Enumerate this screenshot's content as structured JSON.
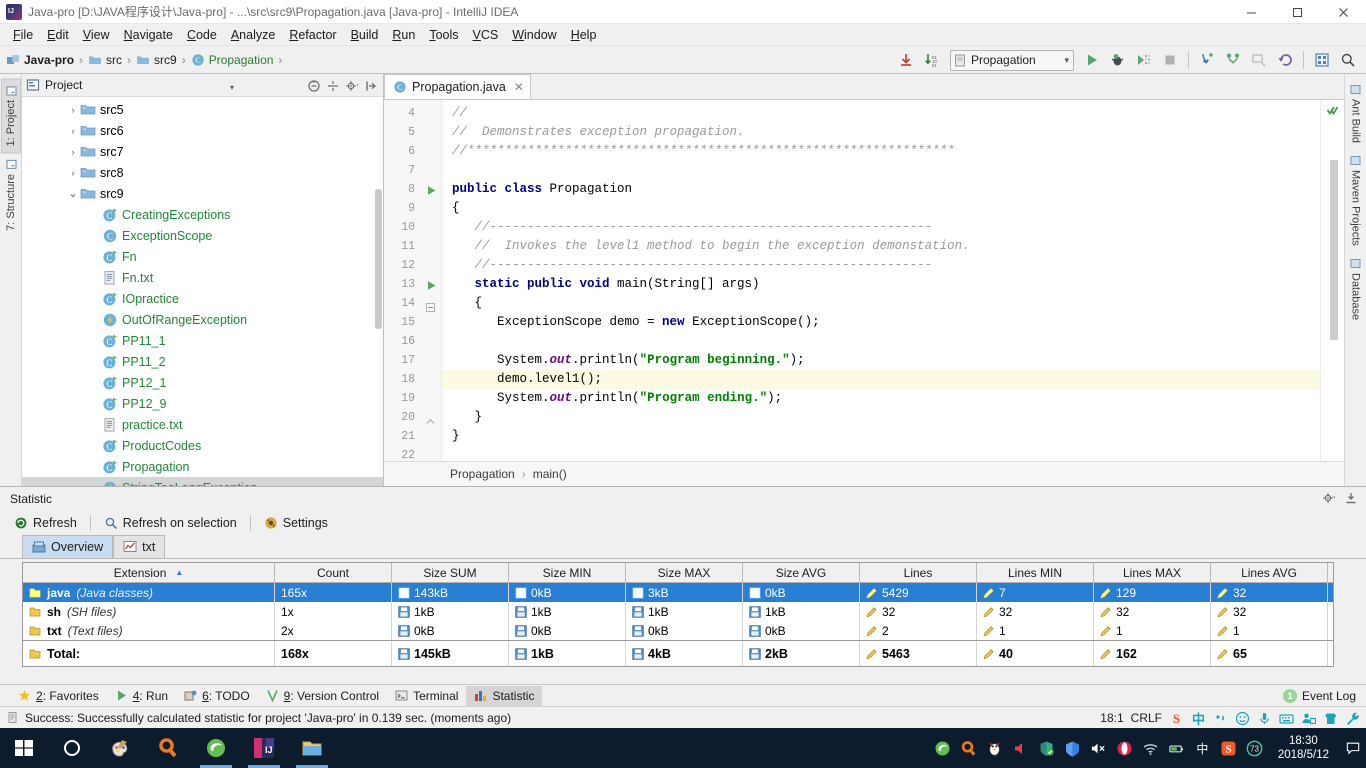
{
  "window": {
    "title": "Java-pro [D:\\JAVA程序设计\\Java-pro] - ...\\src\\src9\\Propagation.java [Java-pro] - IntelliJ IDEA",
    "app_icon": "intellij-idea-icon",
    "minimize": "–",
    "maximize": "❐",
    "close": "✕"
  },
  "menubar": {
    "items": [
      {
        "label": "File"
      },
      {
        "label": "Edit"
      },
      {
        "label": "View"
      },
      {
        "label": "Navigate"
      },
      {
        "label": "Code"
      },
      {
        "label": "Analyze"
      },
      {
        "label": "Refactor"
      },
      {
        "label": "Build"
      },
      {
        "label": "Run"
      },
      {
        "label": "Tools"
      },
      {
        "label": "VCS"
      },
      {
        "label": "Window"
      },
      {
        "label": "Help"
      }
    ]
  },
  "navbar": {
    "breadcrumb": [
      {
        "label": "Java-pro",
        "icon": "module-icon"
      },
      {
        "label": "src",
        "icon": "folder-icon"
      },
      {
        "label": "src9",
        "icon": "folder-icon"
      },
      {
        "label": "Propagation",
        "icon": "java-class-icon"
      }
    ],
    "separator": "›",
    "run_config": {
      "label": "Propagation",
      "caret": "▾",
      "icon": "run-config-icon"
    },
    "buttons": [
      {
        "name": "update-project-icon"
      },
      {
        "name": "compare-icon"
      },
      {
        "name": "run-icon"
      },
      {
        "name": "debug-icon"
      },
      {
        "name": "run-coverage-icon"
      },
      {
        "name": "stop-icon"
      },
      {
        "name": "vcs-update-icon"
      },
      {
        "name": "vcs-commit-icon"
      },
      {
        "name": "vcs-history-icon"
      },
      {
        "name": "vcs-rollback-icon"
      },
      {
        "name": "database-icon"
      },
      {
        "name": "search-everywhere-icon"
      }
    ]
  },
  "left_strip": {
    "tabs": [
      {
        "label": "1: Project",
        "active": true,
        "icon": "project-icon"
      },
      {
        "label": "7: Structure",
        "active": false,
        "icon": "structure-icon"
      }
    ]
  },
  "right_strip": {
    "tabs": [
      {
        "label": "Ant Build",
        "icon": "ant-icon"
      },
      {
        "label": "Maven Projects",
        "icon": "maven-icon"
      },
      {
        "label": "Database",
        "icon": "database-icon"
      }
    ]
  },
  "project_panel": {
    "title": "Project",
    "caret": "▾",
    "tools": [
      "collapse-all-icon",
      "expand-icon",
      "settings-gear-icon",
      "hide-icon"
    ],
    "tree": [
      {
        "label": "src5",
        "arrow": "›",
        "icon": "folder-icon",
        "indent": 0,
        "kind": "folder"
      },
      {
        "label": "src6",
        "arrow": "›",
        "icon": "folder-icon",
        "indent": 0,
        "kind": "folder"
      },
      {
        "label": "src7",
        "arrow": "›",
        "icon": "folder-icon",
        "indent": 0,
        "kind": "folder"
      },
      {
        "label": "src8",
        "arrow": "›",
        "icon": "folder-icon",
        "indent": 0,
        "kind": "folder"
      },
      {
        "label": "src9",
        "arrow": "⌄",
        "icon": "folder-icon",
        "indent": 0,
        "kind": "folder",
        "expanded": true
      },
      {
        "label": "CreatingExceptions",
        "arrow": "",
        "icon": "java-class-runnable-icon",
        "indent": 1,
        "kind": "class-green"
      },
      {
        "label": "ExceptionScope",
        "arrow": "",
        "icon": "java-class-icon",
        "indent": 1,
        "kind": "class-green"
      },
      {
        "label": "Fn",
        "arrow": "",
        "icon": "java-class-runnable-icon",
        "indent": 1,
        "kind": "class-green"
      },
      {
        "label": "Fn.txt",
        "arrow": "",
        "icon": "text-file-icon",
        "indent": 1,
        "kind": "file-green"
      },
      {
        "label": "IOpractice",
        "arrow": "",
        "icon": "java-class-runnable-icon",
        "indent": 1,
        "kind": "class-green"
      },
      {
        "label": "OutOfRangeException",
        "arrow": "",
        "icon": "exception-class-icon",
        "indent": 1,
        "kind": "class-green"
      },
      {
        "label": "PP11_1",
        "arrow": "",
        "icon": "java-class-runnable-icon",
        "indent": 1,
        "kind": "class-green"
      },
      {
        "label": "PP11_2",
        "arrow": "",
        "icon": "java-class-runnable-icon",
        "indent": 1,
        "kind": "class-green"
      },
      {
        "label": "PP12_1",
        "arrow": "",
        "icon": "java-class-runnable-icon",
        "indent": 1,
        "kind": "class-green"
      },
      {
        "label": "PP12_9",
        "arrow": "",
        "icon": "java-class-runnable-icon",
        "indent": 1,
        "kind": "class-green"
      },
      {
        "label": "practice.txt",
        "arrow": "",
        "icon": "text-file-icon",
        "indent": 1,
        "kind": "file-green"
      },
      {
        "label": "ProductCodes",
        "arrow": "",
        "icon": "java-class-runnable-icon",
        "indent": 1,
        "kind": "class-green"
      },
      {
        "label": "Propagation",
        "arrow": "",
        "icon": "java-class-runnable-icon",
        "indent": 1,
        "kind": "class-green"
      },
      {
        "label": "StringTooLongException",
        "arrow": "",
        "icon": "exception-class-icon",
        "indent": 1,
        "kind": "class-green",
        "selected": true
      }
    ]
  },
  "editor": {
    "tab": {
      "label": "Propagation.java",
      "icon": "java-class-icon",
      "close": "✕"
    },
    "breadcrumb": {
      "class": "Propagation",
      "method": "main()",
      "separator": "›"
    },
    "lines": [
      {
        "num": "4",
        "tokens": [
          {
            "t": "cmt",
            "v": "//"
          }
        ]
      },
      {
        "num": "5",
        "tokens": [
          {
            "t": "cmt",
            "v": "//  Demonstrates exception propagation."
          }
        ]
      },
      {
        "num": "6",
        "tokens": [
          {
            "t": "cmt",
            "v": "//*****************************************************************"
          }
        ]
      },
      {
        "num": "7",
        "tokens": []
      },
      {
        "num": "8",
        "gutter": "run-marker",
        "tokens": [
          {
            "t": "kw",
            "v": "public class "
          },
          {
            "t": "pln",
            "v": "Propagation"
          }
        ]
      },
      {
        "num": "9",
        "tokens": [
          {
            "t": "pln",
            "v": "{"
          }
        ]
      },
      {
        "num": "10",
        "tokens": [
          {
            "t": "cmt",
            "v": "   //-----------------------------------------------------------"
          }
        ]
      },
      {
        "num": "11",
        "tokens": [
          {
            "t": "cmt",
            "v": "   //  Invokes the level1 method to begin the exception demonstation."
          }
        ]
      },
      {
        "num": "12",
        "tokens": [
          {
            "t": "cmt",
            "v": "   //-----------------------------------------------------------"
          }
        ]
      },
      {
        "num": "13",
        "gutter": "run-marker",
        "tokens": [
          {
            "t": "kw",
            "v": "   static public void "
          },
          {
            "t": "pln",
            "v": "main(String[] args)"
          }
        ]
      },
      {
        "num": "14",
        "gutter": "fold-open",
        "tokens": [
          {
            "t": "pln",
            "v": "   {"
          }
        ]
      },
      {
        "num": "15",
        "tokens": [
          {
            "t": "pln",
            "v": "      ExceptionScope demo = "
          },
          {
            "t": "kw",
            "v": "new "
          },
          {
            "t": "pln",
            "v": "ExceptionScope();"
          }
        ]
      },
      {
        "num": "16",
        "tokens": []
      },
      {
        "num": "17",
        "tokens": [
          {
            "t": "pln",
            "v": "      System."
          },
          {
            "t": "fld",
            "v": "out"
          },
          {
            "t": "pln",
            "v": ".println("
          },
          {
            "t": "str",
            "v": "\"Program beginning.\""
          },
          {
            "t": "pln",
            "v": ");"
          }
        ]
      },
      {
        "num": "18",
        "highlight": true,
        "tokens": [
          {
            "t": "pln",
            "v": "      demo.level1();"
          }
        ]
      },
      {
        "num": "19",
        "tokens": [
          {
            "t": "pln",
            "v": "      System."
          },
          {
            "t": "fld",
            "v": "out"
          },
          {
            "t": "pln",
            "v": ".println("
          },
          {
            "t": "str",
            "v": "\"Program ending.\""
          },
          {
            "t": "pln",
            "v": ");"
          }
        ]
      },
      {
        "num": "20",
        "gutter": "fold-close",
        "tokens": [
          {
            "t": "pln",
            "v": "   }"
          }
        ]
      },
      {
        "num": "21",
        "tokens": [
          {
            "t": "pln",
            "v": "}"
          }
        ]
      },
      {
        "num": "22",
        "tokens": []
      }
    ],
    "inspection_status": "no-errors-check-icon"
  },
  "statistic": {
    "panel_title": "Statistic",
    "panel_tools": [
      "settings-gear-icon",
      "hide-panel-icon"
    ],
    "toolbar": [
      {
        "label": "Refresh",
        "icon": "refresh-icon"
      },
      {
        "label": "Refresh on selection",
        "icon": "refresh-selection-icon"
      },
      {
        "label": "Settings",
        "icon": "settings-icon"
      }
    ],
    "tabs": [
      {
        "label": "Overview",
        "icon": "overview-icon",
        "active": true
      },
      {
        "label": "txt",
        "icon": "chart-icon",
        "active": false
      }
    ],
    "table": {
      "columns": [
        {
          "label": "Extension",
          "sorted": true,
          "sort_arrow": "▲"
        },
        {
          "label": "Count"
        },
        {
          "label": "Size SUM"
        },
        {
          "label": "Size MIN"
        },
        {
          "label": "Size MAX"
        },
        {
          "label": "Size AVG"
        },
        {
          "label": "Lines"
        },
        {
          "label": "Lines MIN"
        },
        {
          "label": "Lines MAX"
        },
        {
          "label": "Lines AVG"
        }
      ],
      "rows": [
        {
          "selected": true,
          "ext": "java",
          "ext_desc": "(Java classes)",
          "count": "165x",
          "size_sum": "143kB",
          "size_min": "0kB",
          "size_max": "3kB",
          "size_avg": "0kB",
          "lines": "5429",
          "lines_min": "7",
          "lines_max": "129",
          "lines_avg": "32"
        },
        {
          "selected": false,
          "ext": "sh",
          "ext_desc": "(SH files)",
          "count": "1x",
          "size_sum": "1kB",
          "size_min": "1kB",
          "size_max": "1kB",
          "size_avg": "1kB",
          "lines": "32",
          "lines_min": "32",
          "lines_max": "32",
          "lines_avg": "32"
        },
        {
          "selected": false,
          "ext": "txt",
          "ext_desc": "(Text files)",
          "count": "2x",
          "size_sum": "0kB",
          "size_min": "0kB",
          "size_max": "0kB",
          "size_avg": "0kB",
          "lines": "2",
          "lines_min": "1",
          "lines_max": "1",
          "lines_avg": "1"
        }
      ],
      "total": {
        "label": "Total:",
        "count": "168x",
        "size_sum": "145kB",
        "size_min": "1kB",
        "size_max": "4kB",
        "size_avg": "2kB",
        "lines": "5463",
        "lines_min": "40",
        "lines_max": "162",
        "lines_avg": "65"
      }
    }
  },
  "bottom_tabs": {
    "tabs": [
      {
        "label": "2: Favorites",
        "icon": "star-icon",
        "active": false
      },
      {
        "label": "4: Run",
        "icon": "run-icon",
        "active": false
      },
      {
        "label": "6: TODO",
        "icon": "todo-icon",
        "active": false
      },
      {
        "label": "9: Version Control",
        "icon": "vcs-icon",
        "active": false
      },
      {
        "label": "Terminal",
        "icon": "terminal-icon",
        "active": false
      },
      {
        "label": "Statistic",
        "icon": "statistic-icon",
        "active": true
      }
    ],
    "event_log": {
      "label": "Event Log",
      "count": "1"
    }
  },
  "statusbar": {
    "message": "Success: Successfully calculated statistic for project 'Java-pro' in 0.139 sec. (moments ago)",
    "message_icon": "info-icon",
    "caret_position": "18:1",
    "line_separator": "CRLF",
    "tray": [
      "sogou-s-icon",
      "chinese-mode-icon",
      "punctuation-icon",
      "emoji-icon",
      "mic-icon",
      "keyboard-icon",
      "toolbox-icon",
      "skin-icon",
      "wrench-icon"
    ],
    "cn_label": "中"
  },
  "taskbar": {
    "apps": [
      {
        "name": "start-button-icon"
      },
      {
        "name": "cortana-search-icon"
      },
      {
        "name": "paint-icon"
      },
      {
        "name": "everything-search-icon"
      },
      {
        "name": "browser-icon",
        "open": true
      },
      {
        "name": "intellij-idea-icon",
        "open": true
      },
      {
        "name": "file-explorer-icon",
        "open": true
      }
    ],
    "tray": [
      {
        "name": "browser-tray-icon"
      },
      {
        "name": "everything-tray-icon"
      },
      {
        "name": "qq-penguin-icon"
      },
      {
        "name": "volume-red-icon"
      },
      {
        "name": "security-shield-icon"
      },
      {
        "name": "tencent-pc-manager-icon"
      },
      {
        "name": "speaker-mute-icon"
      },
      {
        "name": "opera-icon"
      },
      {
        "name": "wifi-icon"
      },
      {
        "name": "battery-icon"
      },
      {
        "name": "chinese-input-icon"
      },
      {
        "name": "sogou-icon"
      },
      {
        "name": "cpu-73-icon",
        "value": "73"
      }
    ],
    "clock": {
      "time": "18:30",
      "date": "2018/5/12"
    },
    "action_center": "notification-icon"
  }
}
